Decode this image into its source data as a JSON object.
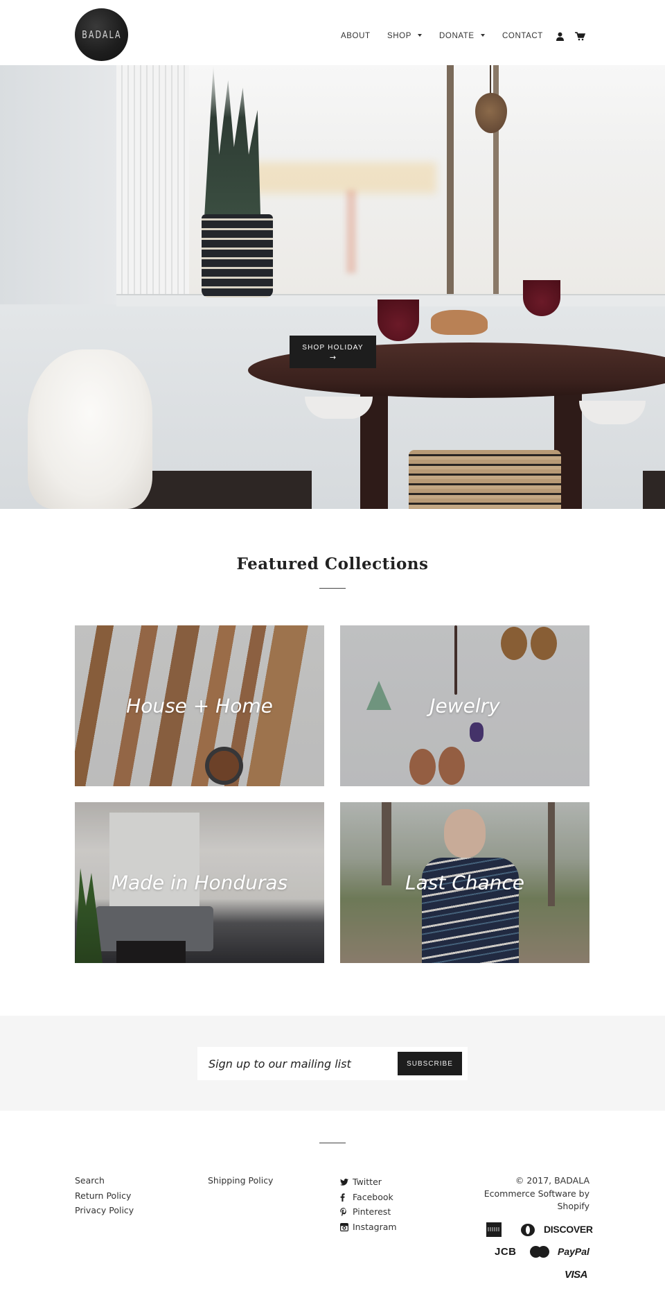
{
  "header": {
    "logo_text": "BADALA",
    "nav": [
      {
        "label": "ABOUT",
        "has_dropdown": false
      },
      {
        "label": "SHOP",
        "has_dropdown": true
      },
      {
        "label": "DONATE",
        "has_dropdown": true
      },
      {
        "label": "CONTACT",
        "has_dropdown": false
      }
    ],
    "icons": {
      "account": "user-icon",
      "cart": "cart-icon"
    }
  },
  "hero": {
    "cta_label": "SHOP HOLIDAY",
    "cta_arrow": "→",
    "slides_total": 4,
    "active_slide": 1
  },
  "featured": {
    "title": "Featured Collections",
    "collections": [
      {
        "label": "House + Home"
      },
      {
        "label": "Jewelry"
      },
      {
        "label": "Made in Honduras"
      },
      {
        "label": "Last Chance"
      }
    ]
  },
  "newsletter": {
    "placeholder": "Sign up to our mailing list",
    "button_label": "SUBSCRIBE"
  },
  "footer": {
    "col1": [
      "Search",
      "Return Policy",
      "Privacy Policy"
    ],
    "col2": [
      "Shipping Policy"
    ],
    "social": [
      {
        "label": "Twitter",
        "icon": "twitter-icon"
      },
      {
        "label": "Facebook",
        "icon": "facebook-icon"
      },
      {
        "label": "Pinterest",
        "icon": "pinterest-icon"
      },
      {
        "label": "Instagram",
        "icon": "instagram-icon"
      }
    ],
    "copyright": "© 2017, BADALA",
    "powered_by": "Ecommerce Software by Shopify",
    "payment_methods": [
      "American Express",
      "Diners Club",
      "DISCOVER",
      "JCB",
      "Master Card",
      "PayPal",
      "VISA"
    ]
  }
}
